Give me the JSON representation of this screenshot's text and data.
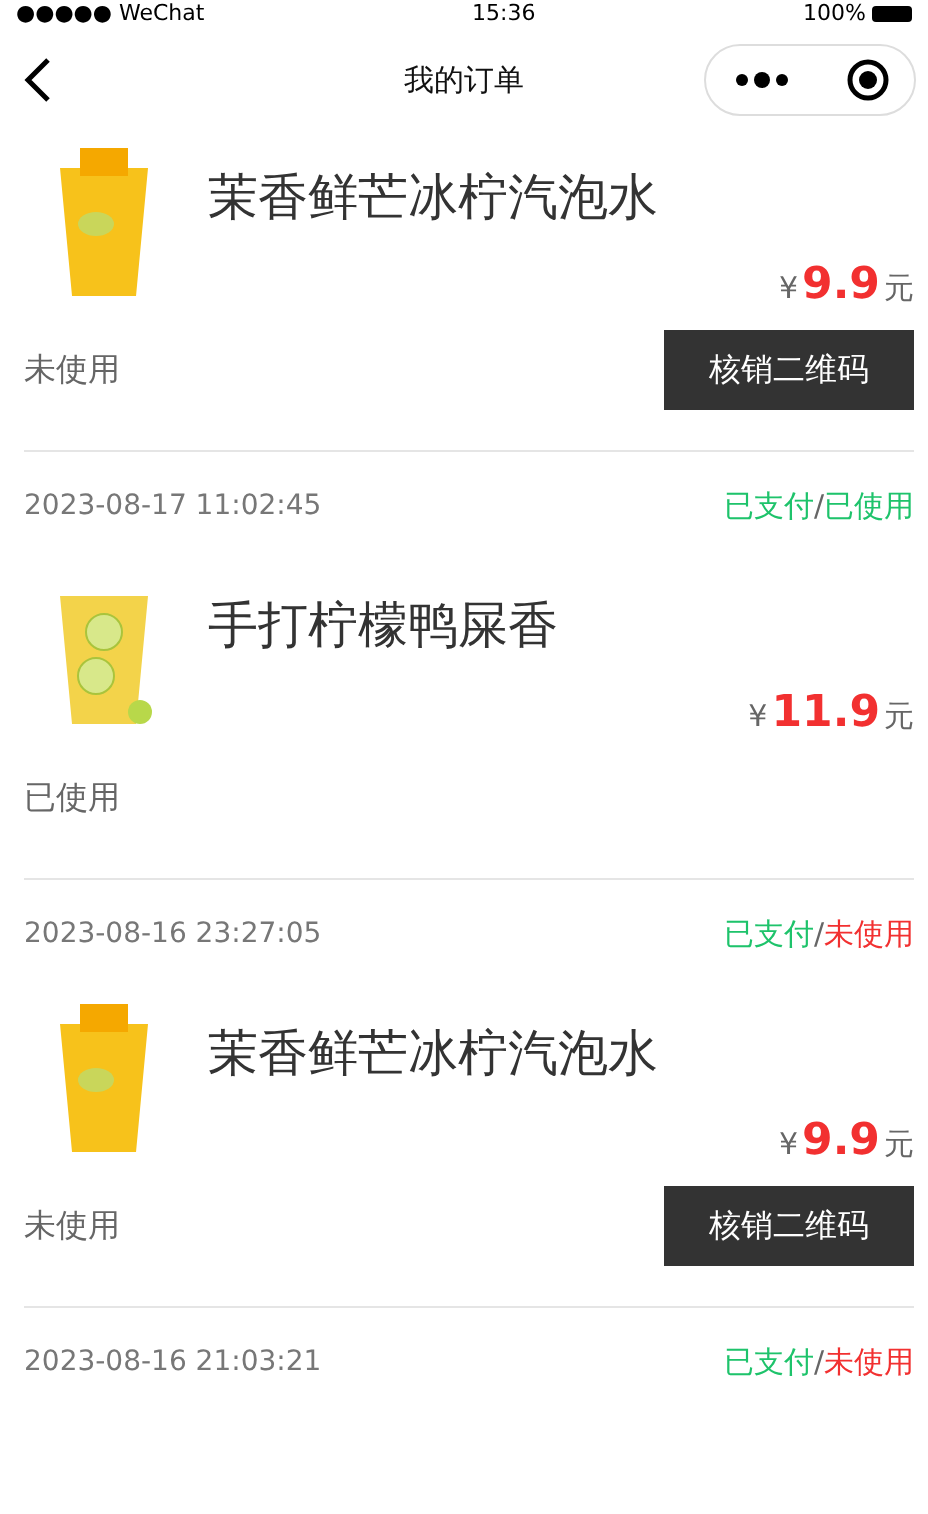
{
  "status_bar": {
    "carrier": "●●●●● WeChat",
    "time": "15:36",
    "battery": "100%"
  },
  "nav": {
    "title": "我的订单"
  },
  "orders": [
    {
      "name": "茉香鲜芒冰柠汽泡水",
      "kind": "mango",
      "currency": "¥",
      "amount": "9.9",
      "unit": "元",
      "status": "未使用",
      "action": "核销二维码",
      "time": "2023-08-17 11:02:45",
      "pay": "已支付",
      "sep": "/",
      "use": "已使用",
      "used": true
    },
    {
      "name": "手打柠檬鸭屎香",
      "kind": "lemon",
      "currency": "¥",
      "amount": "11.9",
      "unit": "元",
      "status": "已使用",
      "time": "2023-08-16 23:27:05",
      "pay": "已支付",
      "sep": "/",
      "use": "未使用",
      "used": false
    },
    {
      "name": "茉香鲜芒冰柠汽泡水",
      "kind": "mango",
      "currency": "¥",
      "amount": "9.9",
      "unit": "元",
      "status": "未使用",
      "action": "核销二维码",
      "time": "2023-08-16 21:03:21",
      "pay": "已支付",
      "sep": "/",
      "use": "未使用",
      "used": false
    }
  ]
}
